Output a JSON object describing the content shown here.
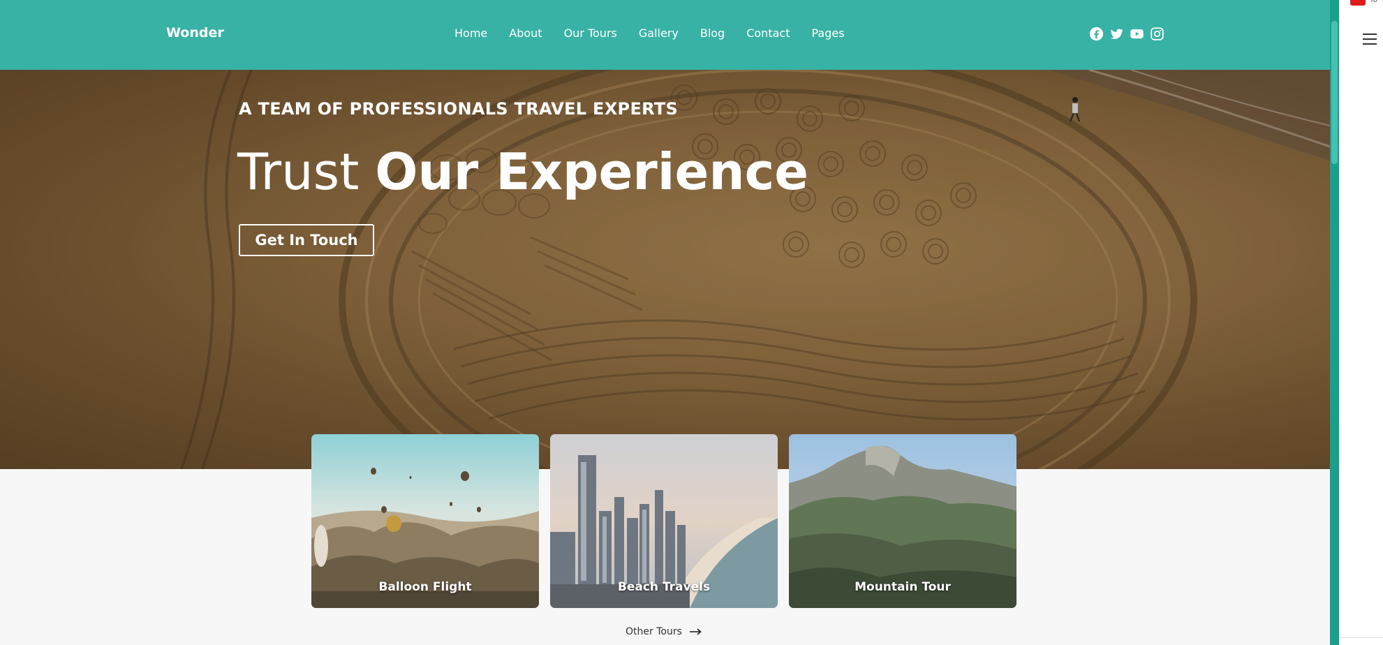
{
  "header": {
    "brand": "Wonder",
    "nav": [
      "Home",
      "About",
      "Our Tours",
      "Gallery",
      "Blog",
      "Contact",
      "Pages"
    ],
    "social_icons": [
      "facebook-icon",
      "twitter-icon",
      "youtube-icon",
      "instagram-icon"
    ]
  },
  "hero": {
    "kicker": "A TEAM OF PROFESSIONALS TRAVEL EXPERTS",
    "title_light": "Trust",
    "title_bold": "Our Experience",
    "cta": "Get In Touch"
  },
  "tours": {
    "cards": [
      {
        "label": "Balloon Flight"
      },
      {
        "label": "Beach Travels"
      },
      {
        "label": "Mountain Tour"
      }
    ],
    "more": "Other Tours"
  },
  "browser_side": {
    "tab_text": "Yo"
  },
  "colors": {
    "header": "#38b2a5",
    "scrollbar": "#18a08d"
  }
}
